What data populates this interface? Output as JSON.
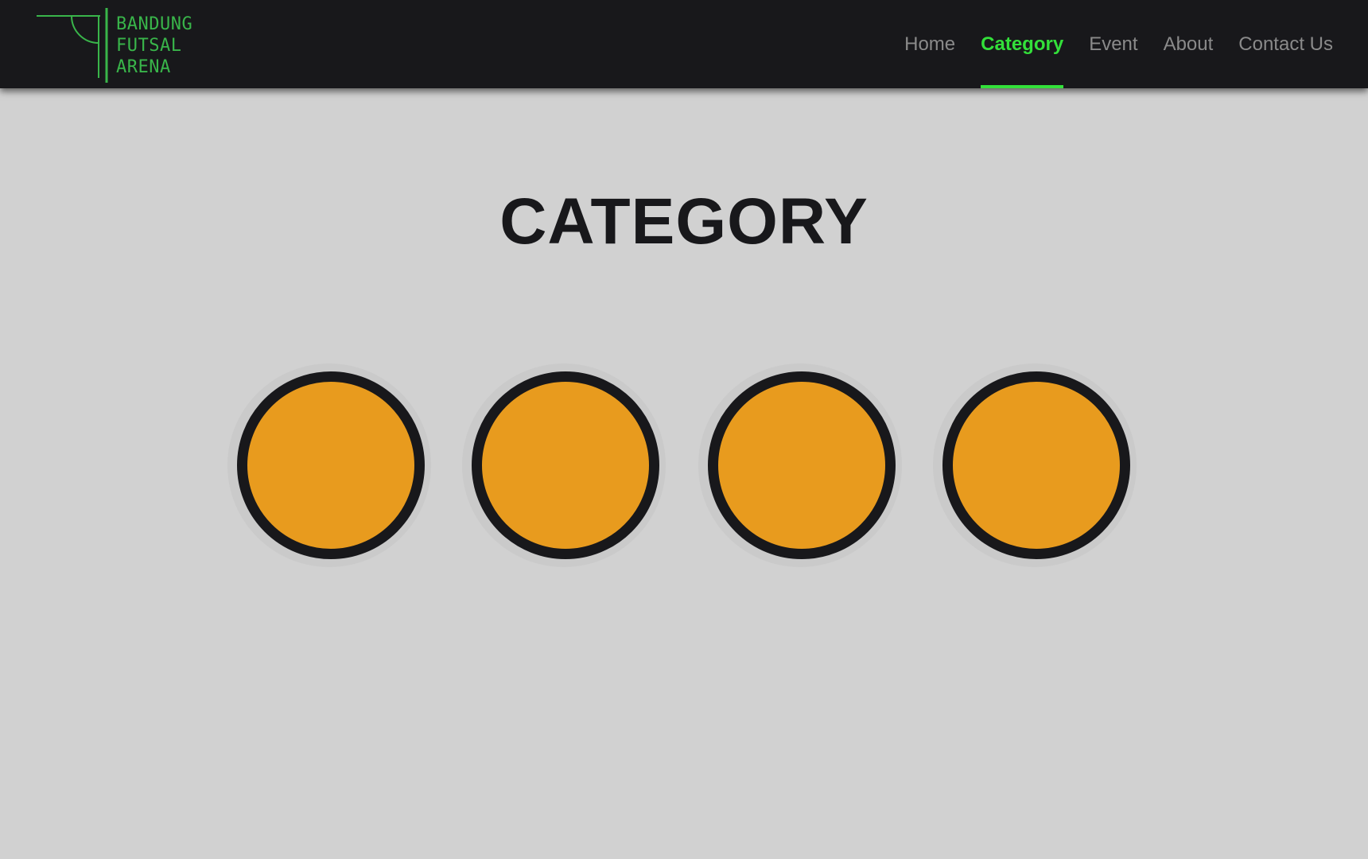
{
  "brand": {
    "lines": [
      "BANDUNG",
      "FUTSAL",
      "ARENA"
    ],
    "color": "#39b54a"
  },
  "nav": {
    "items": [
      {
        "label": "Home",
        "active": false
      },
      {
        "label": "Category",
        "active": true
      },
      {
        "label": "Event",
        "active": false
      },
      {
        "label": "About",
        "active": false
      },
      {
        "label": "Contact Us",
        "active": false
      }
    ],
    "active_color": "#33e03a",
    "inactive_color": "#8a8a8a"
  },
  "main": {
    "title": "CATEGORY",
    "category_count": 4,
    "circle_fill": "#e89b1e",
    "circle_border": "#18181b"
  },
  "colors": {
    "navbar_bg": "#18181b",
    "page_bg": "#d1d1d1"
  }
}
